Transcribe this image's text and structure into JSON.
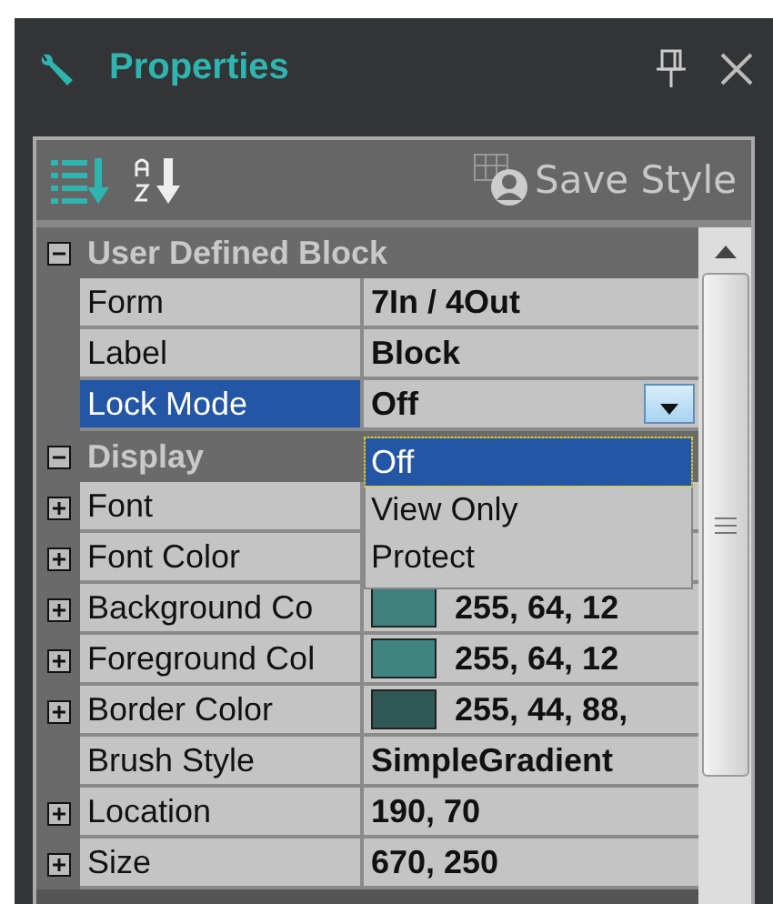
{
  "panel": {
    "title": "Properties"
  },
  "toolbar": {
    "sort_modes": [
      {
        "kind": "categorized",
        "selected": true
      },
      {
        "kind": "alphabetical",
        "selected": false
      }
    ],
    "save_style": "Save Style"
  },
  "categories": [
    {
      "name": "User Defined Block",
      "expanded": true,
      "rows": [
        {
          "name": "Form",
          "value": "7In / 4Out",
          "selected": false
        },
        {
          "name": "Label",
          "value": "Block",
          "selected": false
        },
        {
          "name": "Lock Mode",
          "value": "Off",
          "selected": true
        }
      ]
    },
    {
      "name": "Display",
      "expanded": true,
      "rows": [
        {
          "name": "Font",
          "expandable": true,
          "selected": false
        },
        {
          "name": "Font Color",
          "expandable": true,
          "selected": false
        },
        {
          "name": "Background Co",
          "value": "255, 64, 12",
          "color": "#3f7f7d",
          "expandable": true,
          "selected": false
        },
        {
          "name": "Foreground Col",
          "value": "255, 64, 12",
          "color": "#3f8481",
          "expandable": true,
          "selected": false
        },
        {
          "name": "Border Color",
          "value": "255, 44, 88,",
          "color": "#2f5856",
          "expandable": true,
          "selected": false
        },
        {
          "name": "Brush Style",
          "value": "SimpleGradient",
          "selected": false
        },
        {
          "name": "Location",
          "value": "190, 70",
          "expandable": true,
          "selected": false
        },
        {
          "name": "Size",
          "value": "670, 250",
          "expandable": true,
          "selected": false
        }
      ]
    }
  ],
  "dropdown": {
    "options": [
      {
        "label": "Off",
        "selected": true
      },
      {
        "label": "View Only",
        "selected": false
      },
      {
        "label": "Protect",
        "selected": false
      }
    ]
  }
}
